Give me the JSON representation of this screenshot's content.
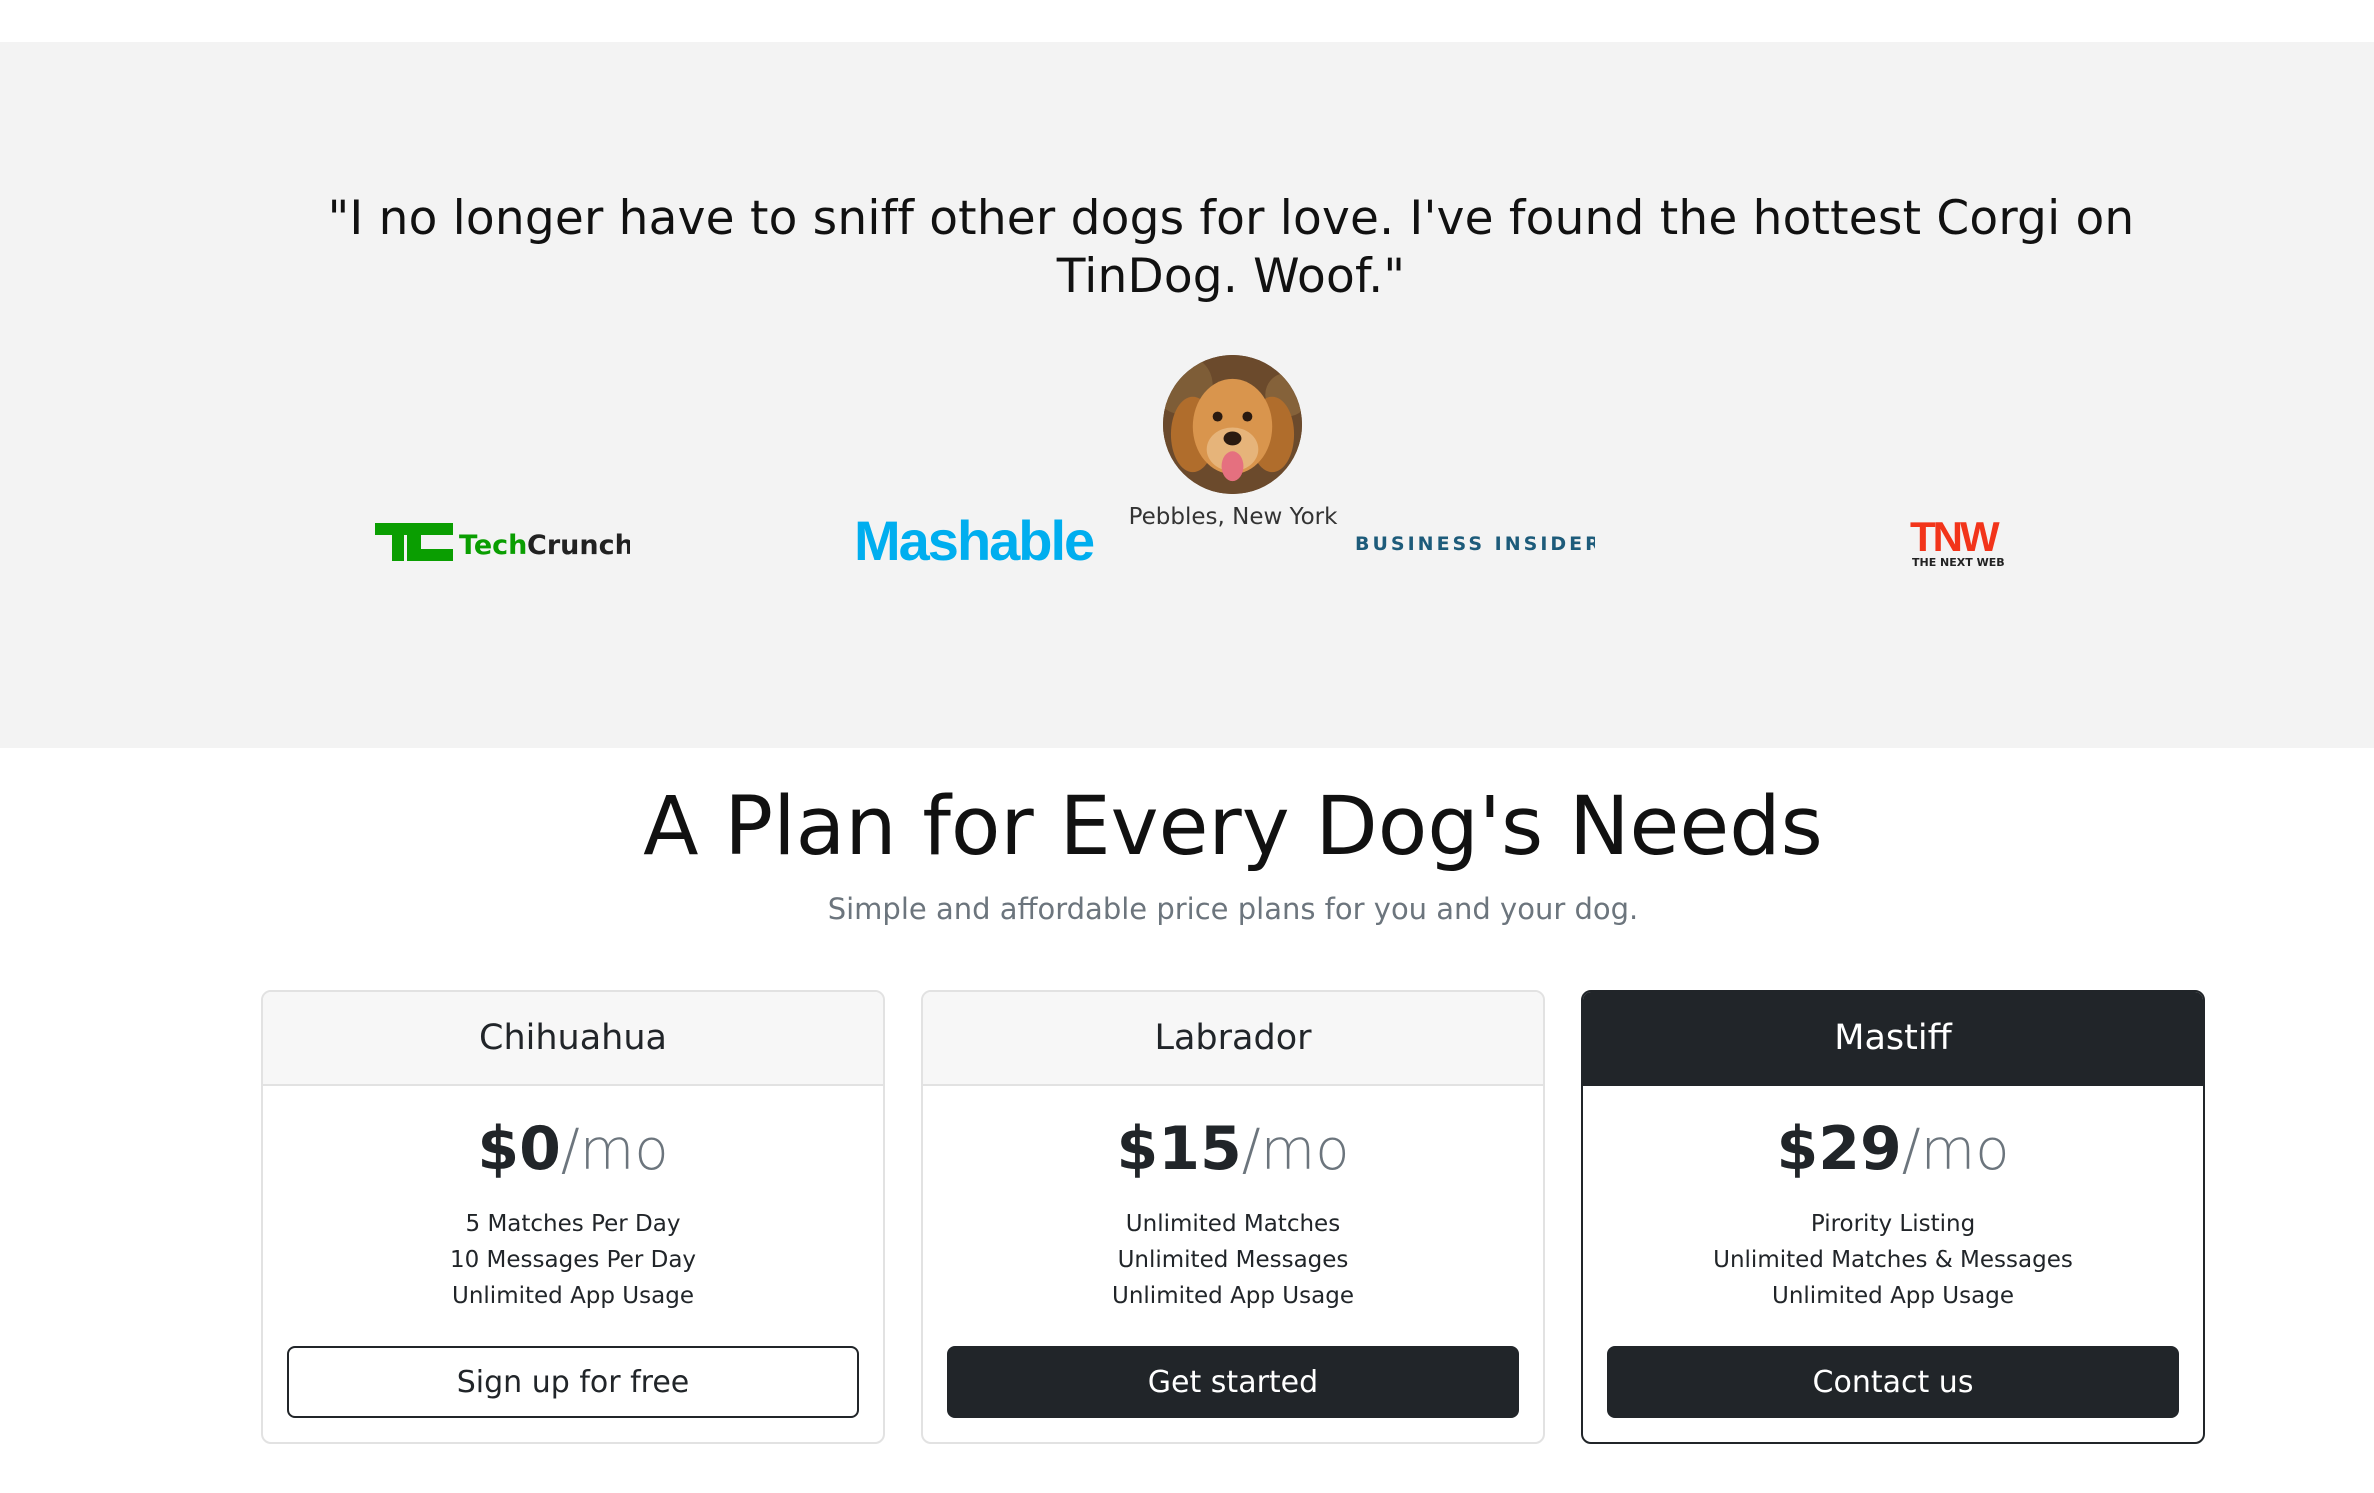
{
  "testimonial": {
    "quote": "\"I no longer have to sniff other dogs for love. I've found the hottest Corgi on TinDog. Woof.\"",
    "author": "Pebbles, New York"
  },
  "press": {
    "techcrunch": {
      "mark": "TC",
      "name": "TechCrunch",
      "color": "#0a9e01"
    },
    "mashable": {
      "name": "Mashable",
      "color": "#00aeef"
    },
    "business_insider": {
      "name": "BUSINESS INSIDER",
      "color": "#1d5b7a"
    },
    "tnw": {
      "mark": "TNW",
      "tagline": "THE NEXT WEB",
      "color": "#f2341a"
    }
  },
  "pricing": {
    "title": "A Plan for Every Dog's Needs",
    "subtitle": "Simple and affordable price plans for you and your dog.",
    "plans": [
      {
        "name": "Chihuahua",
        "price": "$0",
        "period": "/mo",
        "features": [
          "5 Matches Per Day",
          "10 Messages Per Day",
          "Unlimited App Usage"
        ],
        "button": "Sign up for free"
      },
      {
        "name": "Labrador",
        "price": "$15",
        "period": "/mo",
        "features": [
          "Unlimited Matches",
          "Unlimited Messages",
          "Unlimited App Usage"
        ],
        "button": "Get started"
      },
      {
        "name": "Mastiff",
        "price": "$29",
        "period": "/mo",
        "features": [
          "Pirority Listing",
          "Unlimited Matches & Messages",
          "Unlimited App Usage"
        ],
        "button": "Contact us"
      }
    ]
  }
}
